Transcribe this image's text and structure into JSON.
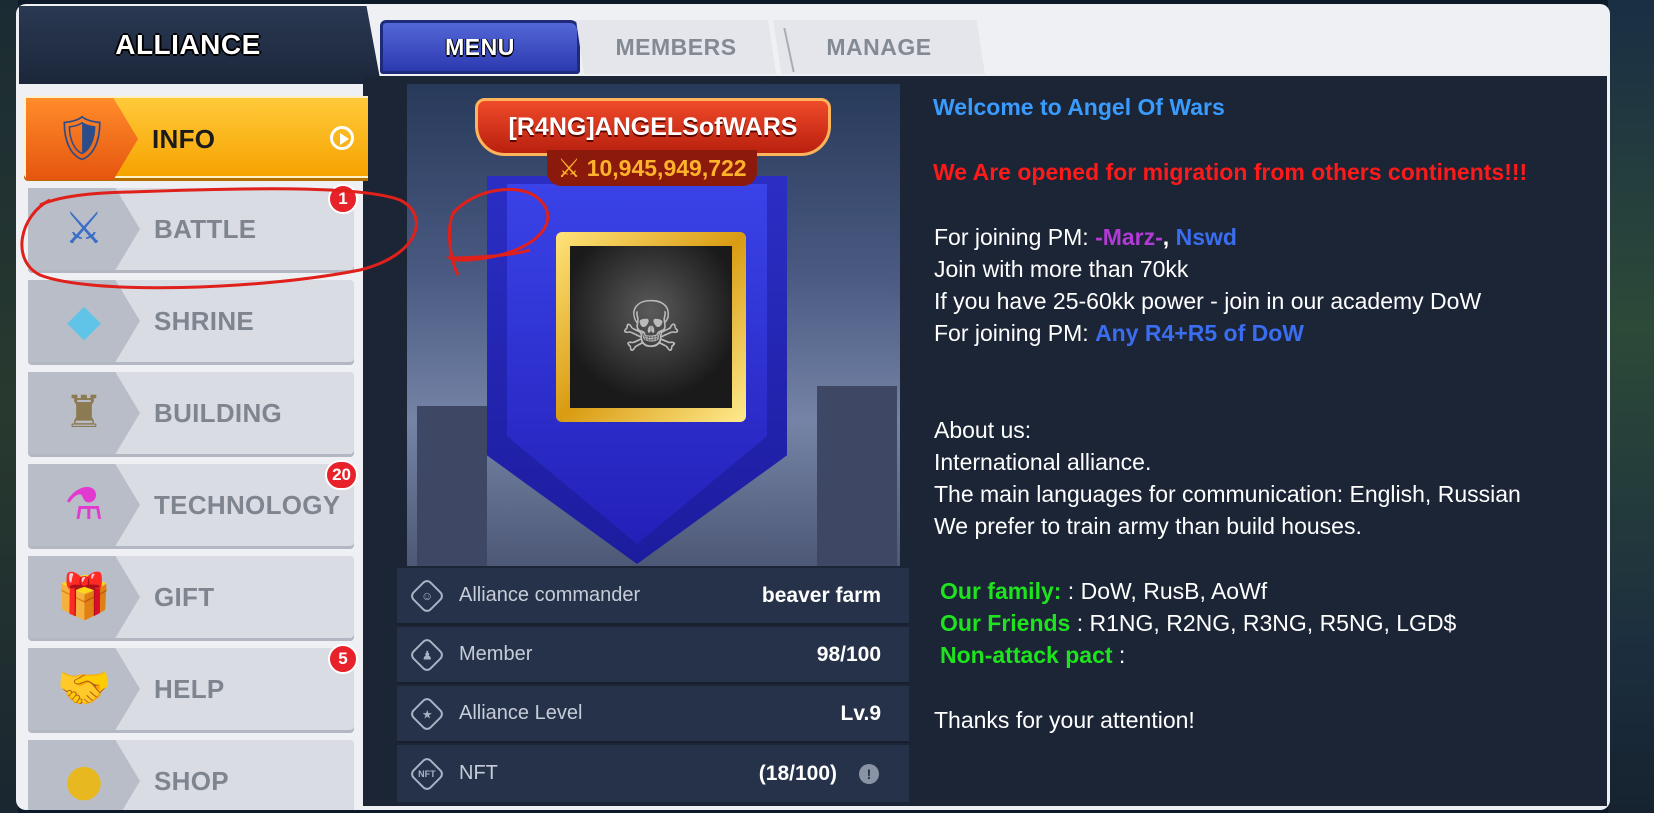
{
  "header": {
    "title": "ALLIANCE",
    "tabs": [
      {
        "label": "MENU",
        "active": true
      },
      {
        "label": "MEMBERS",
        "active": false
      },
      {
        "label": "MANAGE",
        "active": false
      }
    ]
  },
  "sidebar": {
    "items": [
      {
        "label": "INFO",
        "icon": "lion-shield-icon",
        "active": true,
        "badge": ""
      },
      {
        "label": "BATTLE",
        "icon": "crossed-swords-icon",
        "active": false,
        "badge": "1"
      },
      {
        "label": "SHRINE",
        "icon": "crystal-shrine-icon",
        "active": false,
        "badge": ""
      },
      {
        "label": "BUILDING",
        "icon": "castle-icon",
        "active": false,
        "badge": ""
      },
      {
        "label": "TECHNOLOGY",
        "icon": "potion-flask-icon",
        "active": false,
        "badge": "20"
      },
      {
        "label": "GIFT",
        "icon": "gift-box-icon",
        "active": false,
        "badge": ""
      },
      {
        "label": "HELP",
        "icon": "handshake-icon",
        "active": false,
        "badge": "5"
      },
      {
        "label": "SHOP",
        "icon": "coins-icon",
        "active": false,
        "badge": ""
      }
    ]
  },
  "emblem": {
    "name": "[R4NG]ANGELSofWARS",
    "power": "10,945,949,722"
  },
  "stats": [
    {
      "label": "Alliance commander",
      "value": "beaver farm",
      "icon": "commander-icon"
    },
    {
      "label": "Member",
      "value": "98/100",
      "icon": "members-icon"
    },
    {
      "label": "Alliance Level",
      "value": "Lv.9",
      "icon": "star-icon"
    },
    {
      "label": "NFT",
      "value": "(18/100)",
      "icon": "nft-icon"
    }
  ],
  "description": {
    "welcome": "Welcome to Angel Of Wars",
    "migration": "We Are opened for migration from others continents!!!",
    "join_pm_label": "For joining PM: ",
    "join_pm_name1": "-Marz-",
    "join_pm_comma": ", ",
    "join_pm_name2": "Nswd",
    "join_power": "Join with more than 70kk",
    "academy": "If you have  25-60kk power - join in our academy DoW",
    "join_pm_label2": "For joining PM: ",
    "join_pm_target2": "Any R4+R5 of DoW",
    "about": "About us:",
    "international": "International alliance.",
    "languages": "The main languages for communication: English, Russian",
    "prefer": "We prefer to train army than build houses.",
    "family_label": "Our family:",
    "family_value": "  : DoW, RusB, AoWf",
    "friends_label": "Our  Friends",
    "friends_value": " : R1NG, R2NG, R3NG, R5NG, LGD$",
    "nap_label": "Non-attack pact",
    "nap_value": " :",
    "thanks": "Thanks for your attention!"
  },
  "annotation": {
    "number": "2",
    "color": "#e0201a"
  }
}
